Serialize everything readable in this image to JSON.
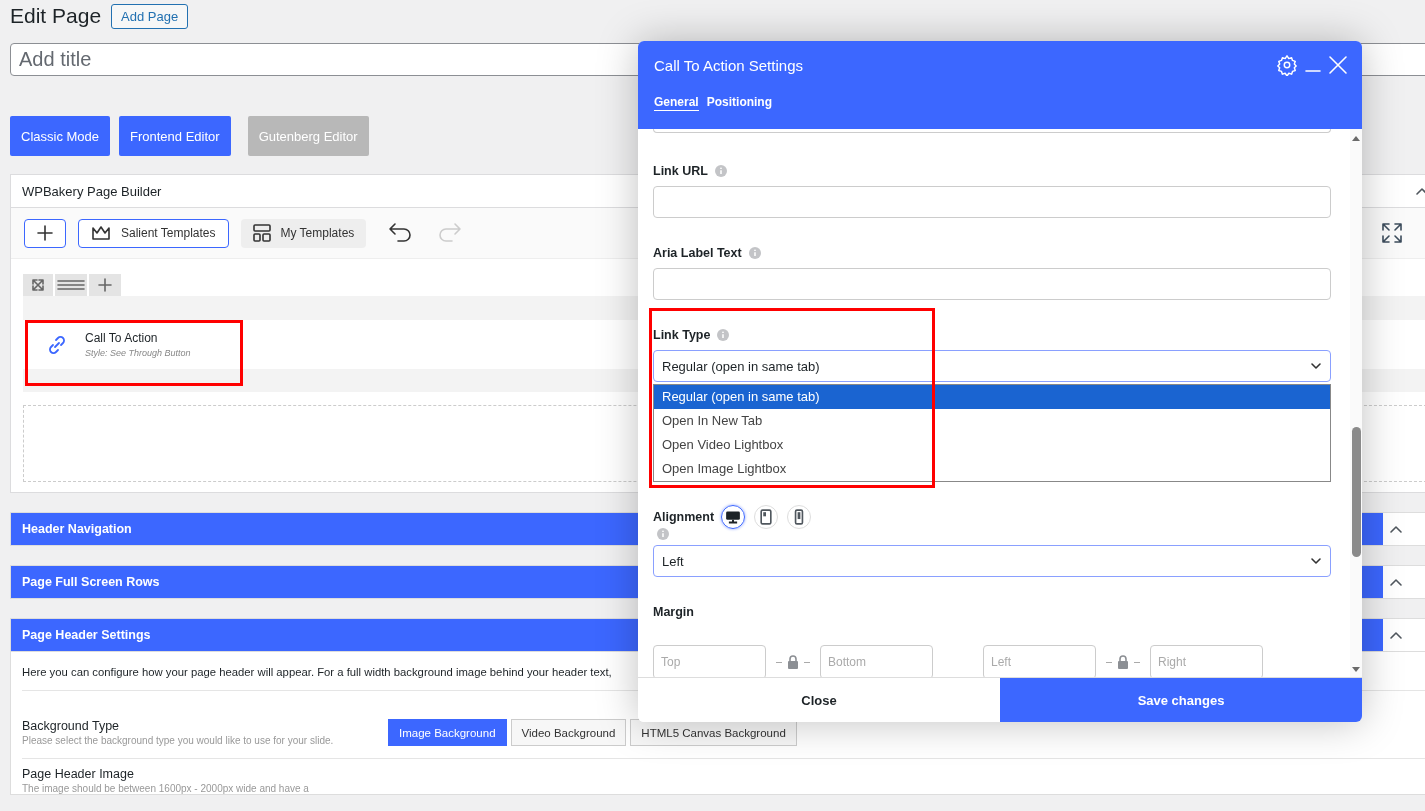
{
  "page": {
    "title": "Edit Page",
    "add_button": "Add Page",
    "title_placeholder": "Add title",
    "editor_modes": [
      {
        "label": "Classic Mode",
        "disabled": false
      },
      {
        "label": "Frontend Editor",
        "disabled": false
      },
      {
        "label": "Gutenberg Editor",
        "disabled": true
      }
    ]
  },
  "builder": {
    "title": "WPBakery Page Builder",
    "templates": [
      "Salient Templates",
      "My Templates"
    ],
    "element": {
      "name": "Call To Action",
      "style": "Style: See Through Button",
      "highlighted": true
    }
  },
  "sections": [
    {
      "title": "Header Navigation",
      "expanded": true
    },
    {
      "title": "Page Full Screen Rows",
      "expanded": true
    },
    {
      "title": "Page Header Settings",
      "expanded": true
    }
  ],
  "header_settings": {
    "intro": "Here you can configure how your page header will appear. For a full width background image behind your header text,",
    "fields": [
      {
        "label": "Background Type",
        "help": "Please select the background type you would like to use for your slide.",
        "options": [
          {
            "label": "Image Background",
            "selected": true
          },
          {
            "label": "Video Background",
            "selected": false
          },
          {
            "label": "HTML5 Canvas Background",
            "selected": false
          }
        ]
      },
      {
        "label": "Page Header Image",
        "help": "The image should be between 1600px - 2000px wide and have a"
      }
    ]
  },
  "modal": {
    "title": "Call To Action Settings",
    "tabs": [
      {
        "label": "General",
        "selected": true
      },
      {
        "label": "Positioning",
        "selected": false
      }
    ],
    "fields": [
      {
        "kind": "text",
        "label": "Link URL",
        "info": true
      },
      {
        "kind": "text",
        "label": "Aria Label Text",
        "info": true
      },
      {
        "kind": "select",
        "label": "Link Type",
        "info": true,
        "value": "Regular (open in same tab)",
        "highlighted": true,
        "options": [
          {
            "label": "Regular (open in same tab)",
            "selected": true
          },
          {
            "label": "Open In New Tab",
            "selected": false
          },
          {
            "label": "Open Video Lightbox",
            "selected": false
          },
          {
            "label": "Open Image Lightbox",
            "selected": false
          }
        ]
      },
      {
        "kind": "select",
        "label": "Alignment",
        "info": true,
        "value": "Left",
        "devices": [
          {
            "kind": "desktop",
            "selected": true
          },
          {
            "kind": "tablet",
            "selected": false
          },
          {
            "kind": "mobile",
            "selected": false
          }
        ]
      },
      {
        "kind": "margin",
        "label": "Margin",
        "placeholders": [
          "Top",
          "Bottom",
          "Left",
          "Right"
        ]
      }
    ],
    "close": "Close",
    "save": "Save changes"
  }
}
